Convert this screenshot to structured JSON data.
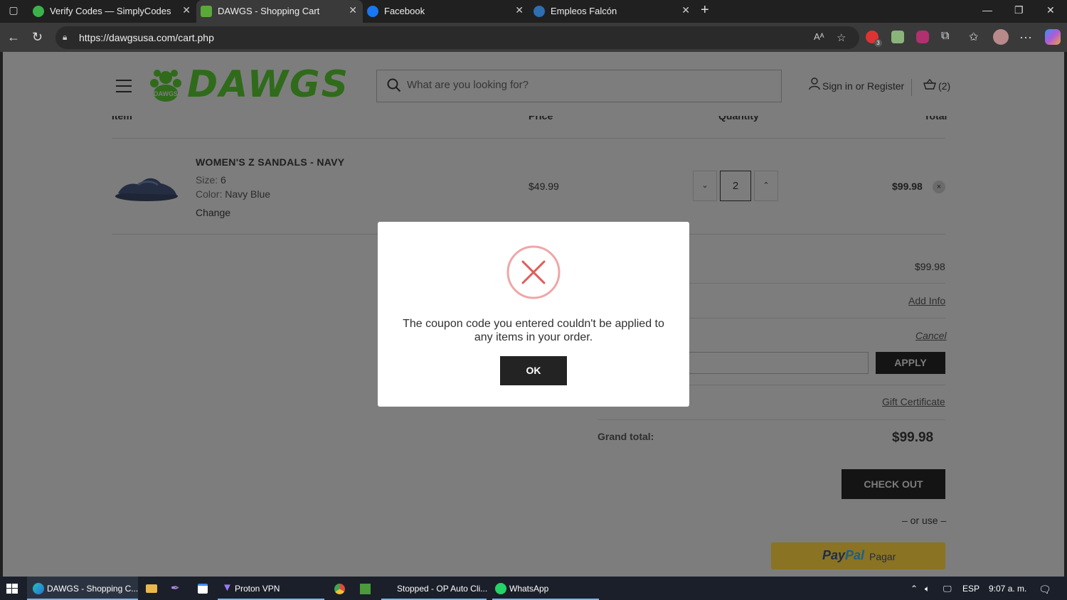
{
  "browser": {
    "tabs": [
      {
        "title": "Verify Codes — SimplyCodes",
        "active": false,
        "favicon_color": "#3bb34a"
      },
      {
        "title": "DAWGS - Shopping Cart",
        "active": true,
        "favicon_color": "#5aa83a"
      },
      {
        "title": "Facebook",
        "active": false,
        "favicon_color": "#1877f2"
      },
      {
        "title": "Empleos Falcón",
        "active": false,
        "favicon_color": "#2d6fb0"
      }
    ],
    "url": "https://dawgsusa.com/cart.php",
    "extension_badge": "3"
  },
  "site": {
    "logo_text": "DAWGS",
    "logo_paw_text": "DAWGS",
    "search_placeholder": "What are you looking for?",
    "signin_label": "Sign in or Register",
    "cart_label": "(2)"
  },
  "cart": {
    "columns": [
      "Item",
      "Price",
      "Quantity",
      "Total"
    ],
    "item": {
      "name": "WOMEN'S Z SANDALS - NAVY",
      "size_label": "Size:",
      "size_value": "6",
      "color_label": "Color:",
      "color_value": "Navy Blue",
      "change_label": "Change",
      "price": "$49.99",
      "quantity": "2",
      "total": "$99.98",
      "remove_icon": "×"
    },
    "summary": {
      "subtotal": "$99.98",
      "shipping_link": "Add Info",
      "coupon_cancel": "Cancel",
      "apply_label": "APPLY",
      "gift_certificate": "Gift Certificate",
      "grand_total_label": "Grand total:",
      "grand_total": "$99.98",
      "checkout_label": "CHECK OUT",
      "or_use": "– or use –",
      "paypal_pay": "Pay",
      "paypal_pal": "Pal",
      "paypal_action": "Pagar"
    }
  },
  "modal": {
    "icon": "error-x-circle",
    "message": "The coupon code you entered couldn't be applied to any items in your order.",
    "ok_label": "OK"
  },
  "taskbar": {
    "items": [
      {
        "label": "DAWGS - Shopping C...",
        "active": true
      },
      {
        "label": "Proton VPN",
        "active": false
      },
      {
        "label": "Stopped - OP Auto Cli...",
        "active": false
      },
      {
        "label": "WhatsApp",
        "active": false
      }
    ],
    "language": "ESP",
    "time": "9:07 a. m."
  },
  "colors": {
    "overlay_page": "#7d7d7d",
    "error_red": "#e25b5b",
    "brand_green": "#5fb832"
  }
}
